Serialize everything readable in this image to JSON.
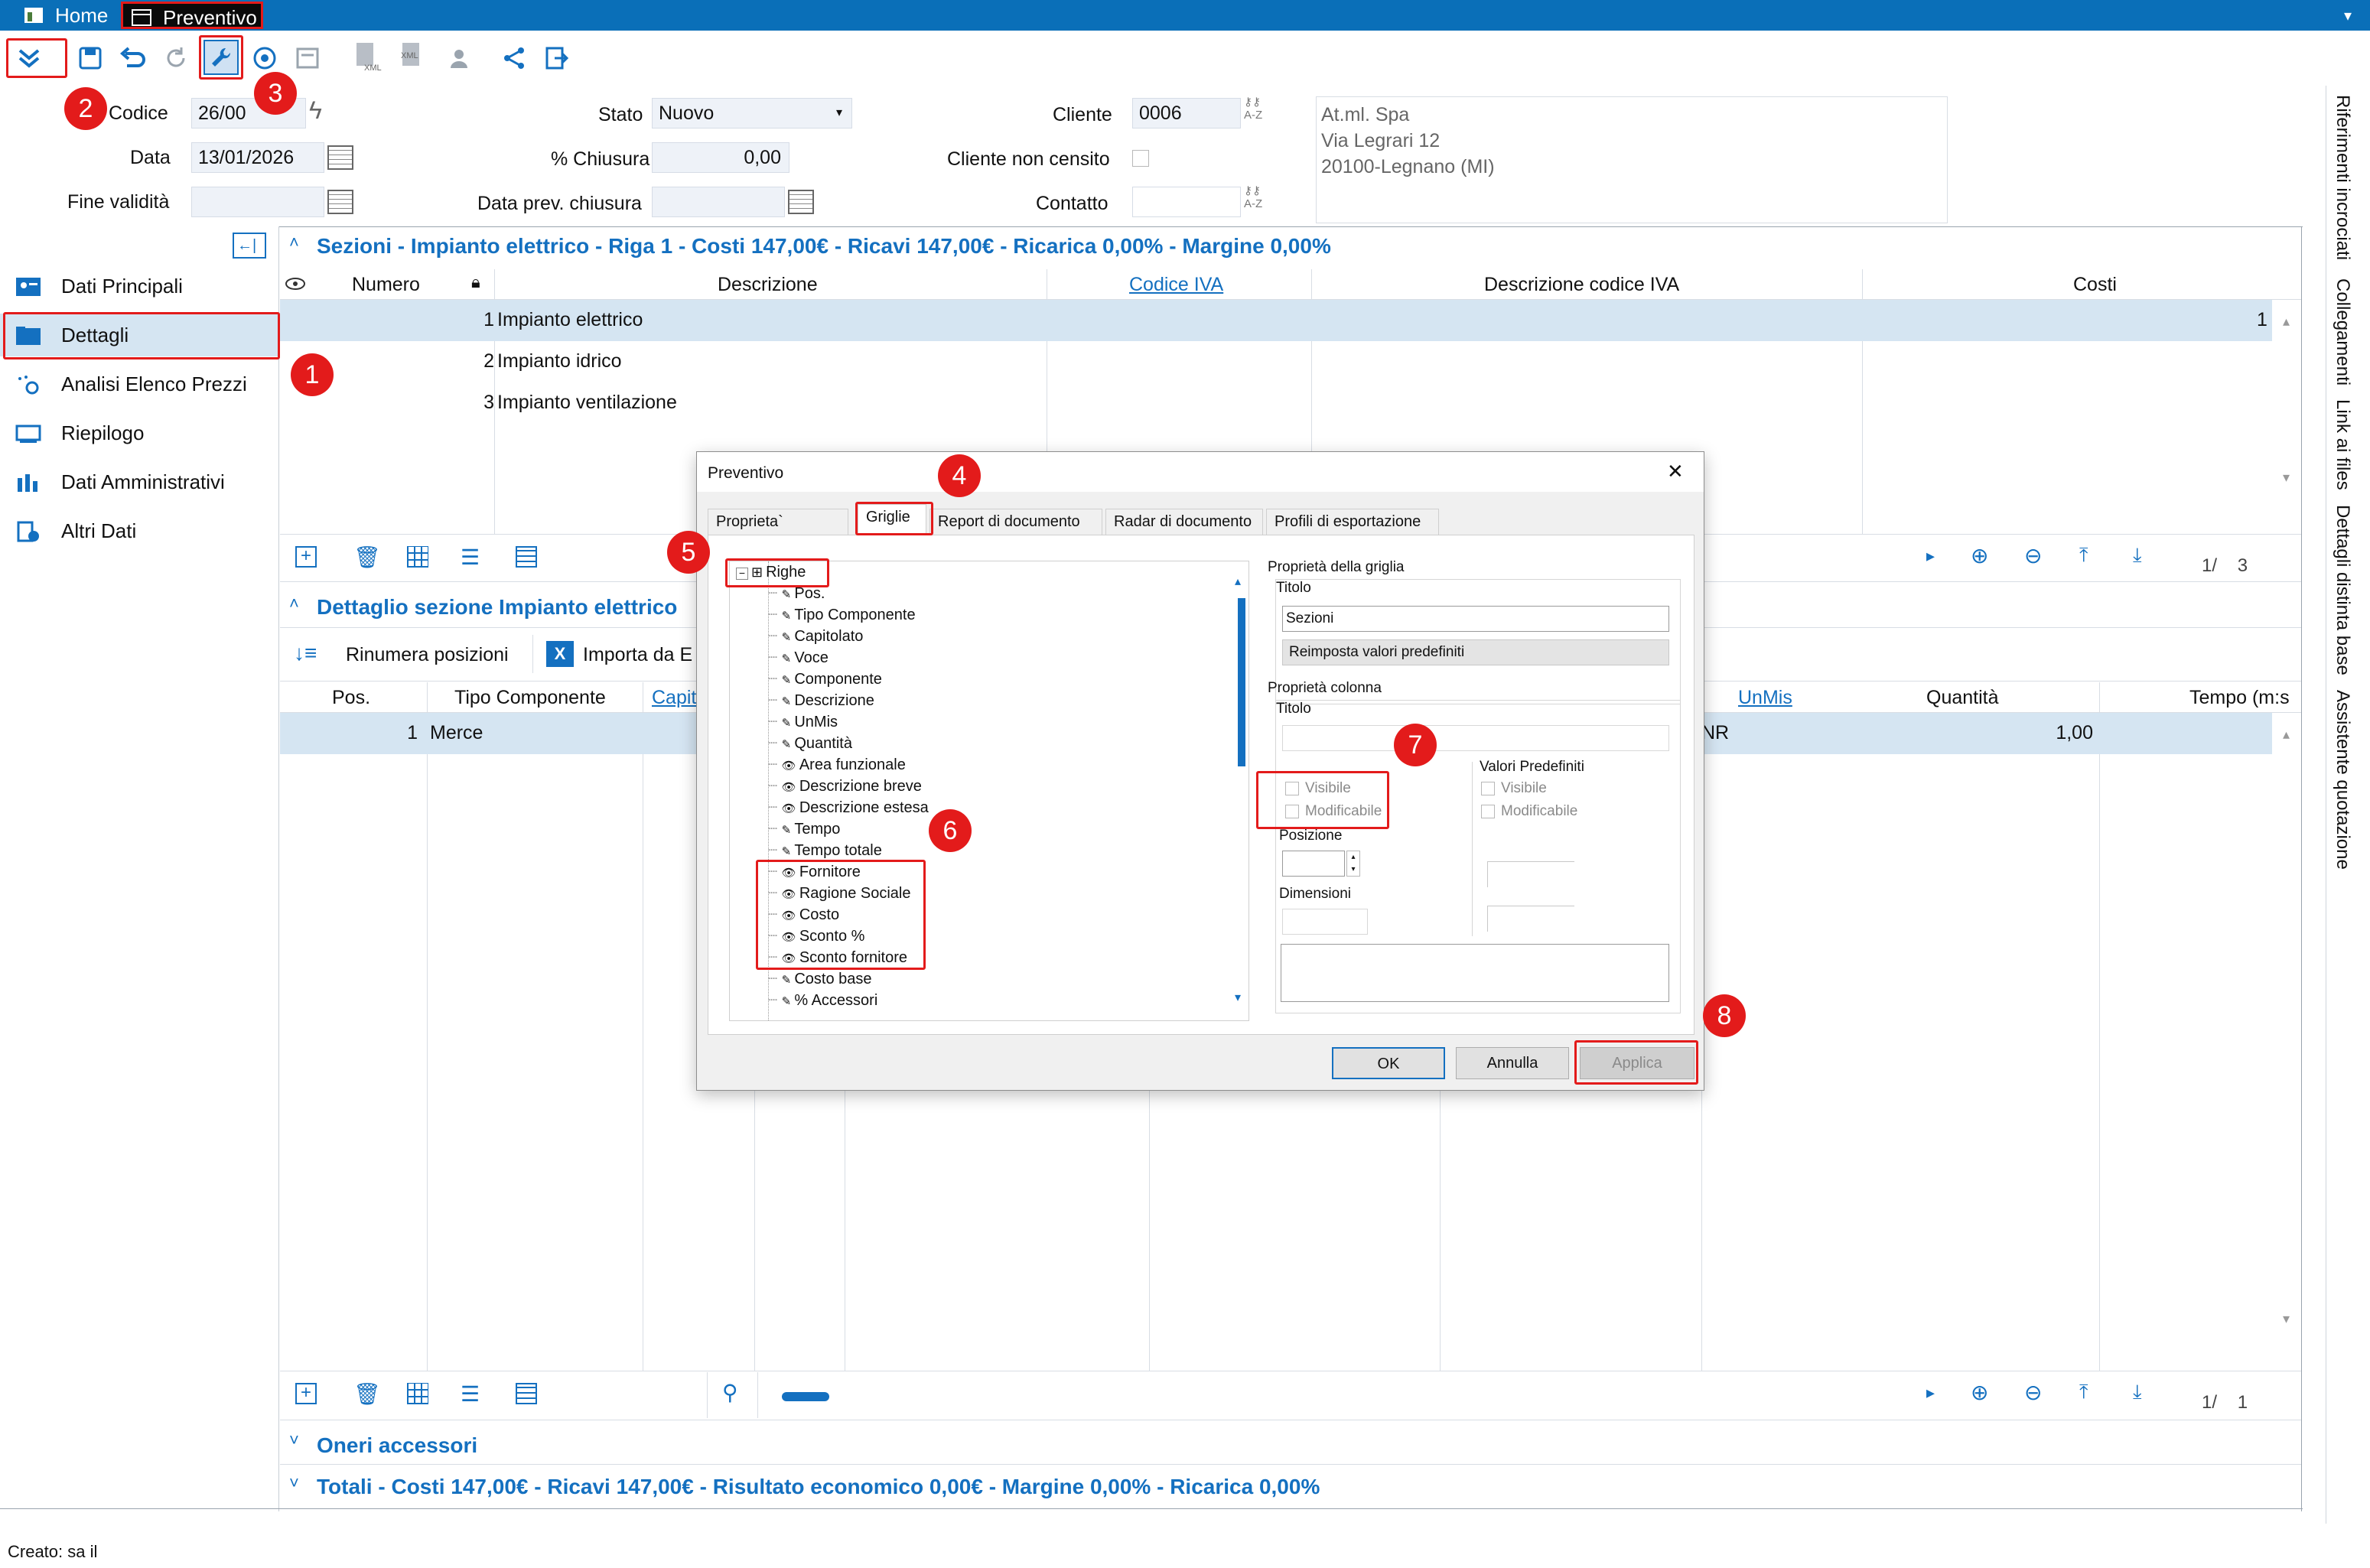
{
  "titlebar": {
    "tabs": [
      {
        "label": "Home"
      },
      {
        "label": "Preventivo"
      }
    ]
  },
  "form": {
    "codice_label": "Codice",
    "codice_value": "26/00",
    "data_label": "Data",
    "data_value": "13/01/2026",
    "fine_validita_label": "Fine validità",
    "stato_label": "Stato",
    "stato_value": "Nuovo",
    "chiusura_label": "% Chiusura",
    "chiusura_value": "0,00",
    "data_prev_label": "Data prev. chiusura",
    "cliente_label": "Cliente",
    "cliente_value": "0006",
    "cliente_non_censito_label": "Cliente non censito",
    "contatto_label": "Contatto",
    "address": [
      "At.ml. Spa",
      "Via Legrari 12",
      "20100-Legnano (MI)"
    ],
    "az_label": "A-Z"
  },
  "sidebar": {
    "items": [
      {
        "label": "Dati Principali"
      },
      {
        "label": "Dettagli"
      },
      {
        "label": "Analisi Elenco Prezzi"
      },
      {
        "label": "Riepilogo"
      },
      {
        "label": "Dati Amministrativi"
      },
      {
        "label": "Altri Dati"
      }
    ]
  },
  "sections": {
    "header": "Sezioni - Impianto elettrico - Riga 1 - Costi 147,00€ - Ricavi 147,00€ - Ricarica 0,00% - Margine 0,00%",
    "columns": [
      "Numero",
      "Descrizione",
      "Codice IVA",
      "Descrizione codice IVA",
      "Costi"
    ],
    "rows": [
      {
        "n": "1",
        "d": "Impianto elettrico",
        "c": "1"
      },
      {
        "n": "2",
        "d": "Impianto idrico"
      },
      {
        "n": "3",
        "d": "Impianto ventilazione"
      }
    ],
    "pager": "1/    3"
  },
  "dettaglio": {
    "header": "Dettaglio sezione Impianto elettrico",
    "rinumera": "Rinumera posizioni",
    "importa": "Importa da E",
    "columns": {
      "pos": "Pos.",
      "tipo": "Tipo Componente",
      "capit": "Capit",
      "unmis": "UnMis",
      "quantita": "Quantità",
      "tempo": "Tempo (m:s"
    },
    "row": {
      "pos": "1",
      "tipo": "Merce",
      "unmis": "NR",
      "quantita": "1,00"
    },
    "pager": "1/    1"
  },
  "oneri": "Oneri accessori",
  "totali": "Totali - Costi 147,00€ - Ricavi 147,00€ - Risultato economico 0,00€ - Margine 0,00% - Ricarica 0,00%",
  "status": "Creato: sa il",
  "rightbar": [
    "Riferimenti incrociati",
    "Collegamenti",
    "Link ai files",
    "Dettagli distinta base",
    "Assistente quotazione"
  ],
  "dialog": {
    "title": "Preventivo",
    "close": "✕",
    "tabs": [
      "Proprieta` generali",
      "Griglie",
      "Report di documento",
      "Radar di documento",
      "Profili di esportazione"
    ],
    "tree_root": "Righe",
    "tree_items": [
      {
        "t": "Pos.",
        "i": "pen"
      },
      {
        "t": "Tipo Componente",
        "i": "pen"
      },
      {
        "t": "Capitolato",
        "i": "pen"
      },
      {
        "t": "Voce",
        "i": "pen"
      },
      {
        "t": "Componente",
        "i": "pen"
      },
      {
        "t": "Descrizione",
        "i": "pen"
      },
      {
        "t": "UnMis",
        "i": "pen"
      },
      {
        "t": "Quantità",
        "i": "pen"
      },
      {
        "t": "Area funzionale",
        "i": "eye"
      },
      {
        "t": "Descrizione breve",
        "i": "eye"
      },
      {
        "t": "Descrizione estesa",
        "i": "eye"
      },
      {
        "t": "Tempo",
        "i": "pen"
      },
      {
        "t": "Tempo totale",
        "i": "pen"
      },
      {
        "t": "Fornitore",
        "i": "eye"
      },
      {
        "t": "Ragione Sociale",
        "i": "eye"
      },
      {
        "t": "Costo",
        "i": "eye"
      },
      {
        "t": "Sconto %",
        "i": "eye"
      },
      {
        "t": "Sconto fornitore",
        "i": "eye"
      },
      {
        "t": "Costo base",
        "i": "pen"
      },
      {
        "t": "% Accessori",
        "i": "pen"
      }
    ],
    "prop_griglia": "Proprietà della griglia",
    "titolo_label": "Titolo",
    "titolo_value": "Sezioni",
    "reimposta": "Reimposta valori predefiniti",
    "prop_colonna": "Proprietà colonna",
    "titolo2_label": "Titolo",
    "visibile": "Visibile",
    "modificabile": "Modificabile",
    "valori_predef": "Valori Predefiniti",
    "visibile2": "Visibile",
    "modificabile2": "Modificabile",
    "posizione": "Posizione",
    "dimensioni": "Dimensioni",
    "ok": "OK",
    "annulla": "Annulla",
    "applica": "Applica"
  },
  "badges": [
    "1",
    "2",
    "3",
    "4",
    "5",
    "6",
    "7",
    "8"
  ],
  "colors": {
    "accent": "#0a6fb8",
    "section_text": "#1470c0",
    "badge": "#e31b1b",
    "selected_row": "#d5e5f2"
  }
}
